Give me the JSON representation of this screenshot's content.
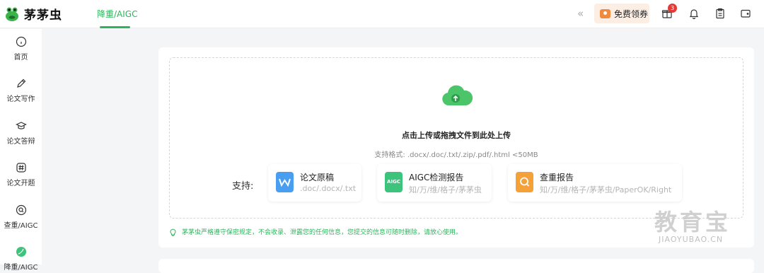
{
  "app": {
    "name": "茅茅虫"
  },
  "nav": {
    "active_tab": "降重/AIGC"
  },
  "header": {
    "coupon_label": "免费领券",
    "notification_count": "3"
  },
  "sidebar": {
    "items": [
      {
        "label": "首页",
        "icon": "home-icon"
      },
      {
        "label": "论文写作",
        "icon": "pen-icon"
      },
      {
        "label": "论文答辩",
        "icon": "graduation-cap-icon"
      },
      {
        "label": "论文开题",
        "icon": "hash-icon"
      },
      {
        "label": "查重/AIGC",
        "icon": "search-icon"
      },
      {
        "label": "降重/AIGC",
        "icon": "leaf-icon",
        "active": true
      }
    ]
  },
  "upload": {
    "title": "点击上传或拖拽文件到此处上传",
    "formats": "支持格式: .docx/.doc/.txt/.zip/.pdf/.html <50MB",
    "support_label": "支持:",
    "options": [
      {
        "title": "论文原稿",
        "sub": ".doc/.docx/.txt",
        "icon": "wps-doc-icon",
        "color": "#4a9ef0"
      },
      {
        "title": "AIGC检测报告",
        "sub": "知/万/维/格子/茅茅虫",
        "icon": "aigc-icon",
        "icon_text": "AIGC",
        "color": "#3cc47c"
      },
      {
        "title": "查重报告",
        "sub": "知/万/维/格子/茅茅虫/PaperOK/Right",
        "icon": "magnifier-report-icon",
        "color": "#f4a13a"
      }
    ]
  },
  "notice": "茅茅虫严格遵守保密规定，不会收录、泄露您的任何信息，您提交的信息可随时删除，请放心使用。",
  "watermark": {
    "main": "教育宝",
    "sub": "JIAOYUBAO.CN"
  },
  "colors": {
    "accent": "#2db55d",
    "badge": "#e53935"
  }
}
